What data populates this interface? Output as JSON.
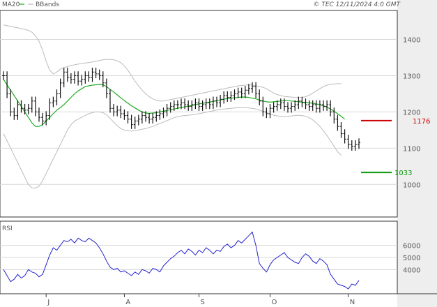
{
  "header": {
    "legend_ma": "MA20",
    "legend_bb": "BBands",
    "copyright": "© TEC 12/11/2024 4:0 GMT"
  },
  "colors": {
    "ma": "#22aa22",
    "bb": "#bbbbbb",
    "price": "#111111",
    "rsi": "#2222cc",
    "resistance": "#cc0000",
    "support": "#119911",
    "grid": "#d8d8d8",
    "axis_panel": "#eeeeee",
    "frame": "#333333"
  },
  "chart_data": [
    {
      "type": "ohlc",
      "title": "",
      "ylim": [
        910,
        1480
      ],
      "y_ticks": [
        1000,
        1100,
        1200,
        1300,
        1400
      ],
      "x_ticks": [
        {
          "label": "J",
          "index": 12
        },
        {
          "label": "A",
          "index": 34
        },
        {
          "label": "S",
          "index": 55
        },
        {
          "label": "O",
          "index": 75
        },
        {
          "label": "N",
          "index": 97
        }
      ],
      "price_close": [
        1300,
        1250,
        1200,
        1190,
        1220,
        1210,
        1205,
        1210,
        1230,
        1200,
        1185,
        1175,
        1190,
        1225,
        1230,
        1250,
        1280,
        1310,
        1295,
        1290,
        1300,
        1285,
        1290,
        1300,
        1295,
        1310,
        1305,
        1300,
        1280,
        1250,
        1210,
        1200,
        1205,
        1195,
        1190,
        1180,
        1165,
        1175,
        1180,
        1190,
        1185,
        1180,
        1185,
        1190,
        1195,
        1200,
        1210,
        1215,
        1220,
        1220,
        1225,
        1220,
        1215,
        1220,
        1225,
        1215,
        1220,
        1225,
        1220,
        1230,
        1225,
        1235,
        1245,
        1240,
        1245,
        1250,
        1255,
        1250,
        1260,
        1265,
        1270,
        1250,
        1230,
        1200,
        1195,
        1210,
        1215,
        1220,
        1225,
        1215,
        1210,
        1215,
        1220,
        1230,
        1225,
        1220,
        1215,
        1220,
        1210,
        1220,
        1215,
        1220,
        1200,
        1180,
        1160,
        1140,
        1125,
        1110,
        1105,
        1110,
        1115
      ],
      "ma20": [
        1290,
        1275,
        1260,
        1245,
        1230,
        1215,
        1200,
        1185,
        1170,
        1160,
        1160,
        1165,
        1175,
        1185,
        1195,
        1205,
        1212,
        1220,
        1230,
        1240,
        1250,
        1258,
        1264,
        1270,
        1272,
        1274,
        1275,
        1276,
        1275,
        1270,
        1262,
        1255,
        1247,
        1239,
        1231,
        1224,
        1217,
        1211,
        1205,
        1200,
        1197,
        1196,
        1197,
        1198,
        1200,
        1202,
        1204,
        1206,
        1208,
        1210,
        1212,
        1214,
        1216,
        1218,
        1220,
        1222,
        1224,
        1225,
        1227,
        1229,
        1231,
        1233,
        1235,
        1237,
        1238,
        1239,
        1240,
        1241,
        1241,
        1240,
        1238,
        1236,
        1233,
        1230,
        1228,
        1227,
        1228,
        1229,
        1230,
        1231,
        1231,
        1230,
        1229,
        1228,
        1227,
        1226,
        1225,
        1224,
        1222,
        1220,
        1217,
        1213,
        1208,
        1202,
        1195,
        1188,
        1180
      ],
      "bb_upper": [
        1440,
        1438,
        1436,
        1434,
        1432,
        1430,
        1428,
        1425,
        1420,
        1410,
        1395,
        1370,
        1340,
        1315,
        1305,
        1310,
        1318,
        1322,
        1325,
        1328,
        1330,
        1332,
        1333,
        1335,
        1336,
        1338,
        1340,
        1342,
        1344,
        1345,
        1345,
        1344,
        1341,
        1336,
        1327,
        1315,
        1300,
        1285,
        1272,
        1260,
        1250,
        1242,
        1236,
        1232,
        1230,
        1230,
        1232,
        1234,
        1236,
        1238,
        1240,
        1242,
        1244,
        1246,
        1248,
        1250,
        1252,
        1254,
        1256,
        1258,
        1260,
        1262,
        1264,
        1266,
        1268,
        1270,
        1272,
        1273,
        1274,
        1275,
        1274,
        1272,
        1270,
        1268,
        1264,
        1258,
        1252,
        1248,
        1245,
        1243,
        1242,
        1241,
        1240,
        1240,
        1240,
        1242,
        1246,
        1252,
        1258,
        1264,
        1270,
        1274,
        1276,
        1277,
        1278,
        1278
      ],
      "bb_lower": [
        1140,
        1120,
        1100,
        1080,
        1060,
        1040,
        1020,
        1000,
        990,
        990,
        995,
        1010,
        1030,
        1050,
        1070,
        1090,
        1110,
        1130,
        1150,
        1165,
        1175,
        1180,
        1185,
        1190,
        1195,
        1198,
        1200,
        1200,
        1198,
        1192,
        1182,
        1172,
        1162,
        1154,
        1150,
        1148,
        1147,
        1148,
        1150,
        1152,
        1154,
        1157,
        1160,
        1164,
        1168,
        1172,
        1176,
        1180,
        1184,
        1187,
        1189,
        1190,
        1191,
        1192,
        1193,
        1195,
        1197,
        1199,
        1201,
        1203,
        1205,
        1207,
        1208,
        1209,
        1210,
        1211,
        1212,
        1212,
        1212,
        1211,
        1210,
        1208,
        1205,
        1202,
        1198,
        1194,
        1191,
        1189,
        1188,
        1188,
        1188,
        1189,
        1190,
        1191,
        1190,
        1188,
        1184,
        1178,
        1170,
        1160,
        1148,
        1135,
        1120,
        1105,
        1090,
        1080
      ],
      "levels": [
        {
          "label": "1176",
          "value": 1176,
          "role": "resistance"
        },
        {
          "label": "1033",
          "value": 1033,
          "role": "support"
        }
      ]
    },
    {
      "type": "line",
      "title": "RSI",
      "ylim": [
        20,
        80
      ],
      "y_ticks": [
        {
          "value": 40,
          "label": "4000"
        },
        {
          "value": 50,
          "label": "5000"
        },
        {
          "value": 60,
          "label": "6000"
        }
      ],
      "x_ticks": [
        {
          "label": "J",
          "index": 12
        },
        {
          "label": "A",
          "index": 34
        },
        {
          "label": "S",
          "index": 55
        },
        {
          "label": "O",
          "index": 75
        },
        {
          "label": "N",
          "index": 97
        }
      ],
      "values": [
        40,
        35,
        30,
        32,
        36,
        33,
        35,
        40,
        38,
        37,
        34,
        36,
        44,
        52,
        58,
        56,
        60,
        64,
        63,
        65,
        62,
        66,
        64,
        63,
        66,
        64,
        62,
        58,
        53,
        47,
        42,
        40,
        41,
        38,
        39,
        37,
        35,
        38,
        36,
        40,
        39,
        37,
        41,
        40,
        38,
        43,
        46,
        49,
        51,
        54,
        56,
        53,
        57,
        55,
        52,
        56,
        54,
        58,
        56,
        53,
        56,
        55,
        59,
        61,
        58,
        60,
        64,
        62,
        65,
        68,
        71,
        60,
        45,
        41,
        38,
        44,
        48,
        50,
        52,
        54,
        50,
        48,
        46,
        45,
        50,
        53,
        51,
        47,
        45,
        49,
        47,
        44,
        36,
        32,
        28,
        27,
        26,
        24,
        28,
        27,
        31
      ],
      "legend": "none"
    }
  ]
}
